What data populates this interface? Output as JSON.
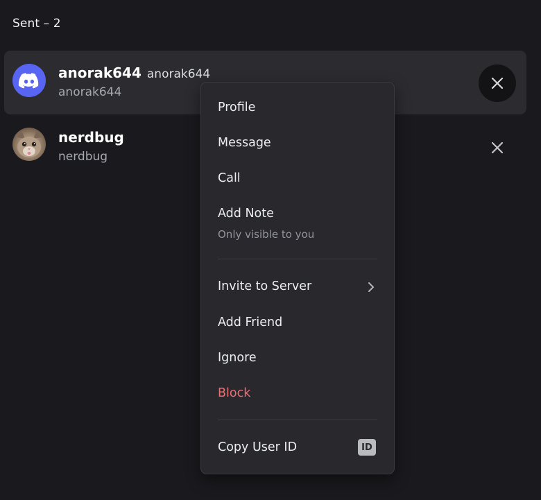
{
  "section": {
    "header": "Sent – 2"
  },
  "requests": [
    {
      "display_name": "anorak644",
      "username_inline": "anorak644",
      "username": "anorak644",
      "avatar_icon": "discord-logo-icon"
    },
    {
      "display_name": "nerdbug",
      "username": "nerdbug",
      "avatar_icon": "cat-photo-avatar"
    }
  ],
  "context_menu": {
    "profile": "Profile",
    "message": "Message",
    "call": "Call",
    "add_note": "Add Note",
    "add_note_sub": "Only visible to you",
    "invite_to_server": "Invite to Server",
    "add_friend": "Add Friend",
    "ignore": "Ignore",
    "block": "Block",
    "copy_user_id": "Copy User ID",
    "id_badge": "ID"
  },
  "colors": {
    "background": "#1a1a1e",
    "menu_bg": "#28282d",
    "blurple": "#5865f2",
    "danger": "#f06e73"
  }
}
